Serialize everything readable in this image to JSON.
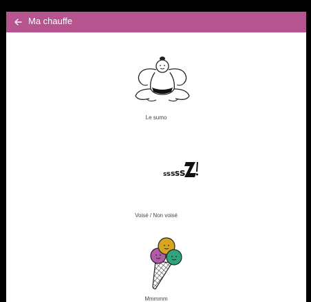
{
  "appbar": {
    "title": "Ma chauffe",
    "background": "#b5548e",
    "back_icon": "arrow-left-icon"
  },
  "items": [
    {
      "label": "Le sumo",
      "icon": "sumo-wrestler-illustration"
    },
    {
      "label": "Voisé / Non voisé",
      "icon": "zzz-sleep-illustration"
    },
    {
      "label": "Mmmmm",
      "icon": "ice-cream-cone-illustration"
    }
  ],
  "colors": {
    "scoop_pink": "#b05aa8",
    "scoop_yellow": "#d7a51f",
    "scoop_green": "#2fa47e"
  }
}
